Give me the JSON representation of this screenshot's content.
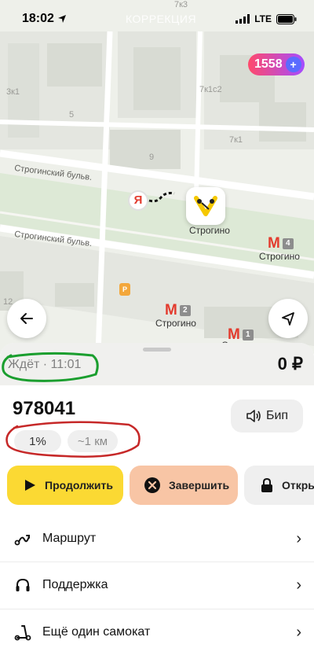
{
  "status_bar": {
    "time": "18:02",
    "network": "LTE"
  },
  "overlay_title": "КОРРЕКЦИЯ",
  "points": {
    "value": "1558"
  },
  "map": {
    "building_numbers": [
      "3к1",
      "5",
      "7к3",
      "7к1с2",
      "7к1",
      "9",
      "12"
    ],
    "streets": [
      "Строгинский бульв.",
      "Строгинский бульв."
    ],
    "metro": [
      {
        "name": "Строгино",
        "line": "4"
      },
      {
        "name": "Строгино",
        "line": "2"
      },
      {
        "name": "Строгино",
        "line": "1"
      }
    ],
    "scooter_label": "Строгино",
    "yandex_pin": "Я",
    "parking_label": "P"
  },
  "sheet": {
    "wait_text": "Ждёт · 11:01",
    "price": "0 ₽",
    "scooter_id": "978041",
    "beep_label": "Бип",
    "battery": "1%",
    "range": "~1 км",
    "actions": {
      "continue": "Продолжить",
      "finish": "Завершить",
      "lock": "Откры"
    },
    "menu": [
      {
        "label": "Маршрут",
        "icon": "route-icon"
      },
      {
        "label": "Поддержка",
        "icon": "headphones-icon"
      },
      {
        "label": "Ещё один самокат",
        "icon": "scooter-icon"
      }
    ]
  },
  "colors": {
    "annotation_green": "#1a9e2e",
    "annotation_red": "#c62828",
    "continue_yellow": "#fbd933",
    "finish_peach": "#f8c5a5",
    "metro_red": "#e33b2e"
  }
}
